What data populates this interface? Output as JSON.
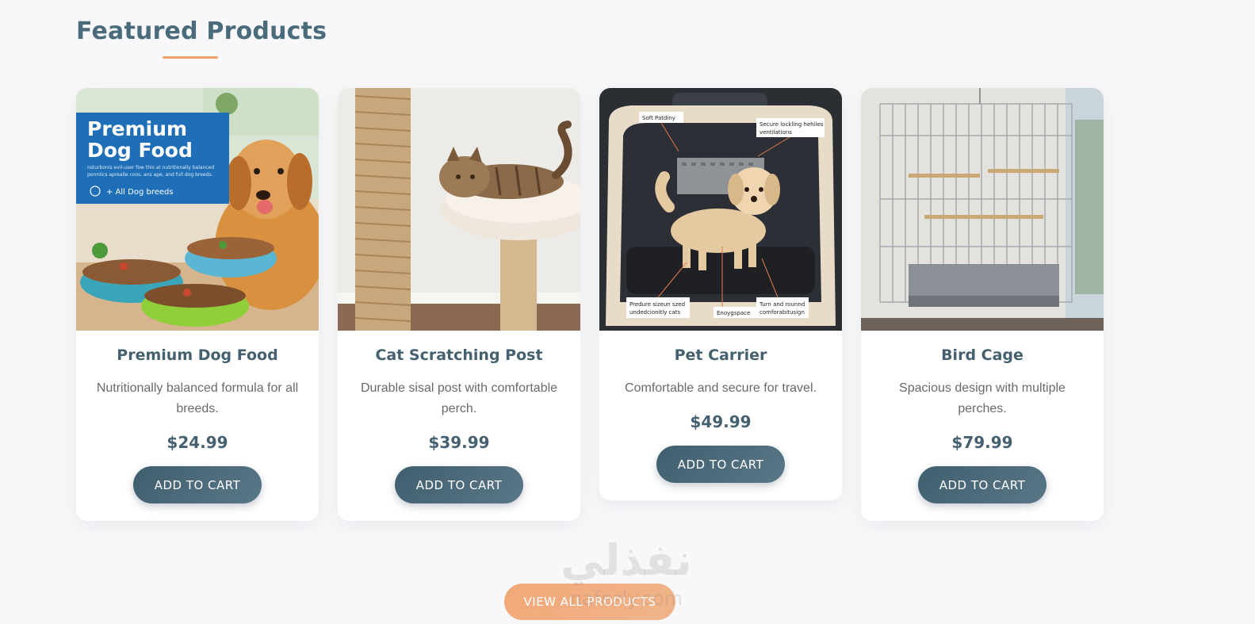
{
  "section": {
    "title": "Featured Products"
  },
  "products": [
    {
      "name": "Premium Dog Food",
      "description": "Nutritionally balanced formula for all breeds.",
      "price": "$24.99",
      "button": "ADD TO CART",
      "image": {
        "banner_title_line1": "Premium",
        "banner_title_line2": "Dog Food",
        "banner_text_line1": "nsturbonis evil-user fow this at nutritionally balanced",
        "banner_text_line2": "pormlics aprealle coos, ans ape, and full dog breeds.",
        "banner_tag": "+ All Dog breeds"
      }
    },
    {
      "name": "Cat Scratching Post",
      "description": "Durable sisal post with comfortable perch.",
      "price": "$39.99",
      "button": "ADD TO CART"
    },
    {
      "name": "Pet Carrier",
      "description": "Comfortable and secure for travel.",
      "price": "$49.99",
      "button": "ADD TO CART",
      "image": {
        "label_top_left": "Soft Patdiny",
        "label_top_right_line1": "Secure lockling hehiles",
        "label_top_right_line2": "ventilations",
        "label_bottom_left_line1": "Predure sizeun szed",
        "label_bottom_left_line2": "undedcionitly cats",
        "label_bottom_mid": "Enoygspace",
        "label_bottom_right_line1": "Turn and rounnd",
        "label_bottom_right_line2": "comforabitusign"
      }
    },
    {
      "name": "Bird Cage",
      "description": "Spacious design with multiple perches.",
      "price": "$79.99",
      "button": "ADD TO CART"
    }
  ],
  "view_all": {
    "label": "VIEW ALL PRODUCTS"
  },
  "watermark": {
    "arabic": "نفذلي",
    "latin": "nafezly.com"
  },
  "colors": {
    "heading": "#4a6b7c",
    "accent": "#f0a070",
    "button": "#45606f"
  }
}
